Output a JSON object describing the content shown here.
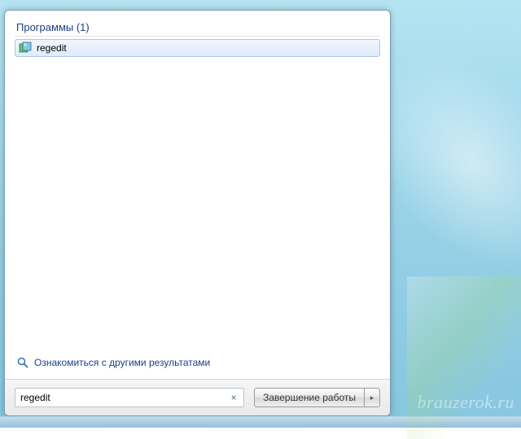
{
  "section": {
    "header": "Программы (1)"
  },
  "results": [
    {
      "label": "regedit",
      "icon": "regedit-icon"
    }
  ],
  "see_more": {
    "label": "Ознакомиться с другими результатами"
  },
  "search": {
    "value": "regedit",
    "clear_glyph": "×"
  },
  "shutdown": {
    "label": "Завершение работы",
    "arrow": "▸"
  },
  "watermark": "brauzerok.ru"
}
